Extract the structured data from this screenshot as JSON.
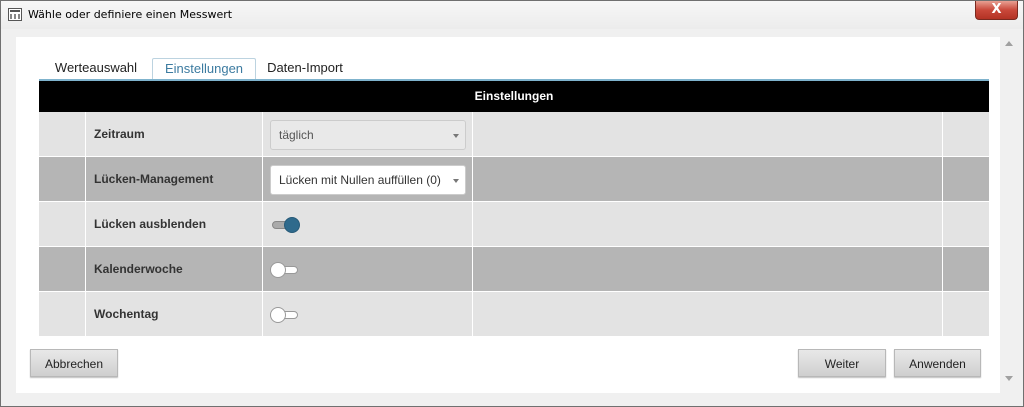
{
  "window": {
    "title": "Wähle oder definiere einen Messwert",
    "close_glyph": "X"
  },
  "tabs": [
    {
      "label": "Werteauswahl",
      "active": false
    },
    {
      "label": "Einstellungen",
      "active": true
    },
    {
      "label": "Daten-Import",
      "active": false
    }
  ],
  "table": {
    "header": "Einstellungen",
    "rows": [
      {
        "label": "Zeitraum",
        "control": "select",
        "value": "täglich",
        "disabled": true
      },
      {
        "label": "Lücken-Management",
        "control": "select",
        "value": "Lücken mit Nullen auffüllen (0)",
        "disabled": false
      },
      {
        "label": "Lücken ausblenden",
        "control": "toggle",
        "on": true
      },
      {
        "label": "Kalenderwoche",
        "control": "toggle",
        "on": false
      },
      {
        "label": "Wochentag",
        "control": "toggle",
        "on": false
      }
    ]
  },
  "buttons": {
    "cancel": "Abbrechen",
    "next": "Weiter",
    "apply": "Anwenden"
  },
  "colors": {
    "accent": "#3c7ba0",
    "toggle_on": "#2f6a8c",
    "header_bg": "#000000",
    "row_light": "#e3e3e3",
    "row_dark": "#b5b5b5"
  }
}
